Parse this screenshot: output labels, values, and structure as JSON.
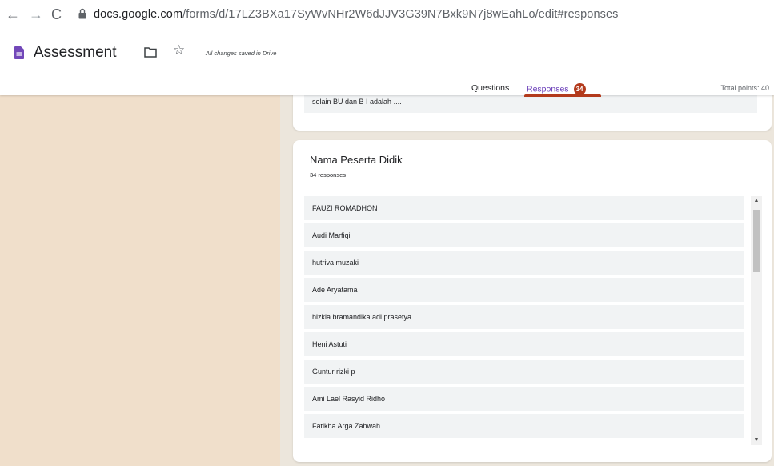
{
  "browser": {
    "back_icon": "←",
    "forward_icon": "→",
    "reload_icon": "C",
    "url_host": "docs.google.com",
    "url_path": "/forms/d/17LZ3BXa17SyWvNHr2W6dJJV3G39N7Bxk9N7j8wEahLo/edit#responses"
  },
  "header": {
    "title": "Assessment",
    "star_icon": "☆",
    "saved_status": "All changes saved in Drive",
    "tabs": {
      "questions": "Questions",
      "responses": "Responses",
      "responses_count": "34"
    },
    "total_points": "Total points: 40",
    "accent_color": "#673ab7",
    "badge_color": "#b33a1c"
  },
  "prev_card": {
    "text": "selain BU dan B I adalah ...."
  },
  "question_card": {
    "title": "Nama Peserta Didik",
    "response_count": "34 responses",
    "responses": [
      "FAUZI ROMADHON",
      "Audi Marfiqi",
      "hutriva muzaki",
      "Ade Aryatama",
      "hizkia bramandika adi prasetya",
      "Heni Astuti",
      "Guntur rizki p",
      "Ami Lael Rasyid Ridho",
      "Fatikha Arga Zahwah"
    ]
  },
  "scrollbar": {
    "up_icon": "▲",
    "down_icon": "▼"
  }
}
